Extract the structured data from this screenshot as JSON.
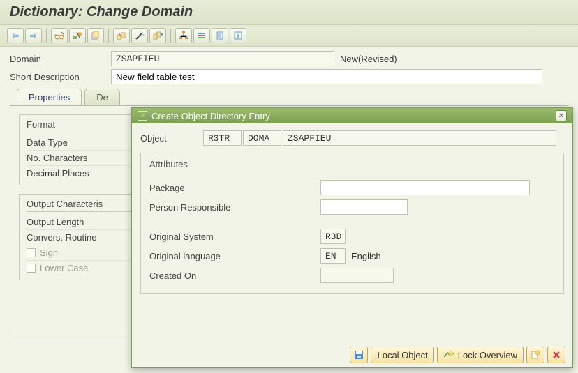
{
  "page_title": "Dictionary: Change Domain",
  "toolbar": {
    "icons": [
      "back",
      "forward",
      "activate",
      "check",
      "copy",
      "check2",
      "toggle",
      "activate2",
      "hierarchy",
      "docu",
      "where",
      "info"
    ]
  },
  "form": {
    "domain_label": "Domain",
    "domain_value": "ZSAPFIEU",
    "status_text": "New(Revised)",
    "short_desc_label": "Short Description",
    "short_desc_value": "New field table test"
  },
  "tabs": {
    "t1": "Properties",
    "t2_partial": "De"
  },
  "sections": {
    "format": {
      "title": "Format",
      "row1": "Data Type",
      "row2": "No. Characters",
      "row3": "Decimal Places"
    },
    "output": {
      "title": "Output Characteris",
      "row1": "Output Length",
      "row2": "Convers. Routine",
      "row3": "Sign",
      "row4": "Lower Case"
    }
  },
  "popup": {
    "title": "Create Object Directory Entry",
    "object_label": "Object",
    "obj_pgmid": "R3TR",
    "obj_type": "DOMA",
    "obj_name": "ZSAPFIEU",
    "attributes_title": "Attributes",
    "package_label": "Package",
    "package_value": "",
    "person_label": "Person Responsible",
    "person_value": "",
    "origsys_label": "Original System",
    "origsys_value": "R3D",
    "origlang_label": "Original language",
    "origlang_value": "EN",
    "origlang_text": "English",
    "created_label": "Created On",
    "created_value": "",
    "btn_local": "Local Object",
    "btn_lock": "Lock Overview"
  }
}
